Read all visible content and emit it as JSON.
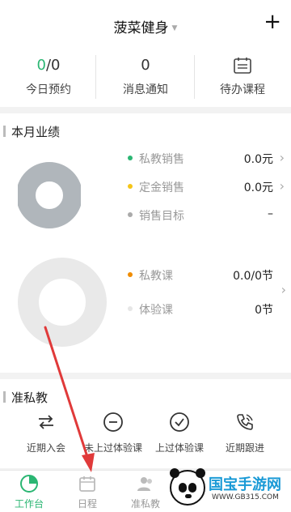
{
  "header": {
    "title": "菠菜健身",
    "add_icon": "plus-icon"
  },
  "stats": [
    {
      "value_highlight": "0",
      "value_rest": "/0",
      "label": "今日预约"
    },
    {
      "value": "0",
      "label": "消息通知"
    },
    {
      "icon": "calendar-list-icon",
      "label": "待办课程"
    }
  ],
  "performance": {
    "title": "本月业绩",
    "sales": [
      {
        "label": "私教销售",
        "value": "0.0元",
        "color": "#2bb673"
      },
      {
        "label": "定金销售",
        "value": "0.0元",
        "color": "#f5c518"
      },
      {
        "label": "销售目标",
        "value": "–",
        "color": "#aaaaaa"
      }
    ],
    "classes": [
      {
        "label": "私教课",
        "value": "0.0/0节",
        "color": "#f08c00"
      },
      {
        "label": "体验课",
        "value": "0节",
        "color": "#e6e6e6"
      }
    ]
  },
  "quick": {
    "title": "准私教",
    "items": [
      {
        "label": "近期入会",
        "icon": "swap-arrows-icon"
      },
      {
        "label": "未上过体验课",
        "icon": "minus-circle-icon"
      },
      {
        "label": "上过体验课",
        "icon": "check-circle-icon"
      },
      {
        "label": "近期跟进",
        "icon": "phone-call-icon"
      }
    ]
  },
  "tabbar": [
    {
      "label": "工作台",
      "icon": "pie-chart-icon",
      "active": true
    },
    {
      "label": "日程",
      "icon": "calendar-icon",
      "active": false
    },
    {
      "label": "准私教",
      "icon": "users-icon",
      "active": false
    }
  ],
  "watermark": {
    "brand": "国宝手游网",
    "url": "WWW.GB315.COM"
  },
  "colors": {
    "accent": "#2bb673",
    "arrow": "#e03a3a",
    "donut": "#b0b6bb"
  }
}
